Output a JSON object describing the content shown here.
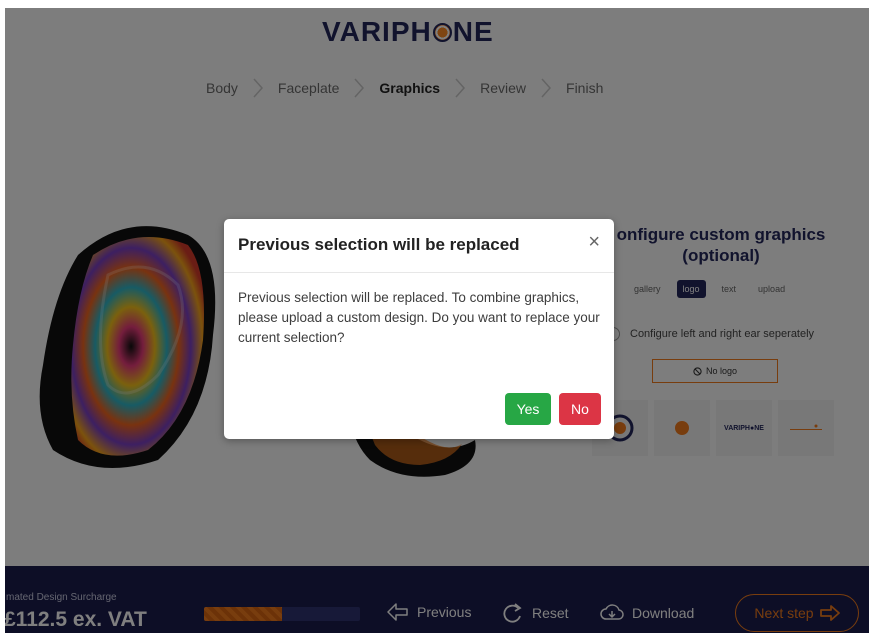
{
  "brand": {
    "logo_text_left": "VARIPH",
    "logo_text_right": "NE"
  },
  "steps": [
    {
      "label": "Body",
      "active": false
    },
    {
      "label": "Faceplate",
      "active": false
    },
    {
      "label": "Graphics",
      "active": true
    },
    {
      "label": "Review",
      "active": false
    },
    {
      "label": "Finish",
      "active": false
    }
  ],
  "side_panel": {
    "title": "onfigure custom graphics (optional)",
    "tabs": [
      {
        "label": "gallery",
        "active": false
      },
      {
        "label": "logo",
        "active": true
      },
      {
        "label": "text",
        "active": false
      },
      {
        "label": "upload",
        "active": false
      }
    ],
    "separate_ears_label": "Configure left and right ear seperately",
    "no_logo_label": "No logo",
    "thumb_logo_text": "VARIPH●NE"
  },
  "bottom_bar": {
    "surcharge_label": "mated Design Surcharge",
    "surcharge_value": "£112.5 ex. VAT",
    "progress_fraction": 0.5,
    "previous_label": "Previous",
    "reset_label": "Reset",
    "download_label": "Download",
    "next_label": "Next step"
  },
  "modal": {
    "title": "Previous selection will be replaced",
    "close_glyph": "×",
    "body": "Previous selection will be replaced. To combine graphics, please upload a custom design. Do you want to replace your current selection?",
    "yes_label": "Yes",
    "no_label": "No"
  },
  "colors": {
    "brand_navy": "#23265b",
    "accent_orange": "#f07a1c",
    "yes_green": "#27a745",
    "no_red": "#dc3545",
    "bottom_bar": "#1b1d4d"
  }
}
